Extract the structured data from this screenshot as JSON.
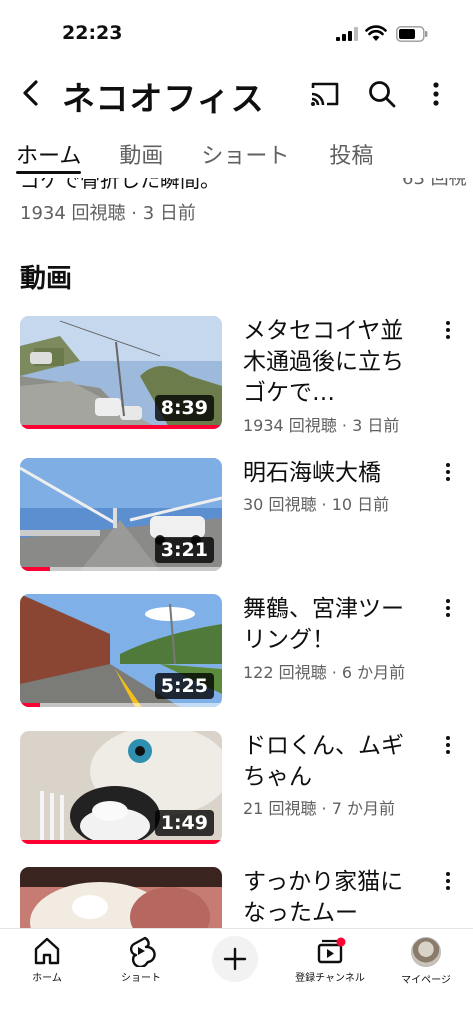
{
  "status_bar": {
    "time": "22:23"
  },
  "header": {
    "channel_name": "ネコオフィス"
  },
  "tabs": [
    {
      "label": "ホーム",
      "active": true
    },
    {
      "label": "動画",
      "active": false
    },
    {
      "label": "ショート",
      "active": false
    },
    {
      "label": "投稿",
      "active": false
    }
  ],
  "previous_item": {
    "title_partial": "ゴケで骨折した瞬間。",
    "right_partial": "63 回視",
    "meta": "1934 回視聴 · 3 日前"
  },
  "section": {
    "title": "動画"
  },
  "videos": [
    {
      "title": "メタセコイヤ並木通過後に立ちゴケで…",
      "meta": "1934 回視聴 · 3 日前",
      "duration": "8:39",
      "progress": 1.0
    },
    {
      "title": "明石海峡大橋",
      "meta": "30 回視聴 · 10 日前",
      "duration": "3:21",
      "progress": 0.15
    },
    {
      "title": "舞鶴、宮津ツーリング！",
      "meta": "122 回視聴 · 6 か月前",
      "duration": "5:25",
      "progress": 0.1
    },
    {
      "title": "ドロくん、ムギちゃん",
      "meta": "21 回視聴 · 7 か月前",
      "duration": "1:49",
      "progress": 1.0
    },
    {
      "title": "すっかり家猫になったムー",
      "meta": "",
      "duration": "",
      "progress": 0
    }
  ],
  "bottom_nav": [
    {
      "label": "ホーム",
      "icon": "home-icon"
    },
    {
      "label": "ショート",
      "icon": "shorts-icon"
    },
    {
      "label": "",
      "icon": "plus-icon"
    },
    {
      "label": "登録チャンネル",
      "icon": "subscriptions-icon"
    },
    {
      "label": "マイページ",
      "icon": "avatar"
    }
  ],
  "colors": {
    "accent": "#ff0033",
    "text": "#0f0f0f",
    "secondary": "#606060"
  }
}
